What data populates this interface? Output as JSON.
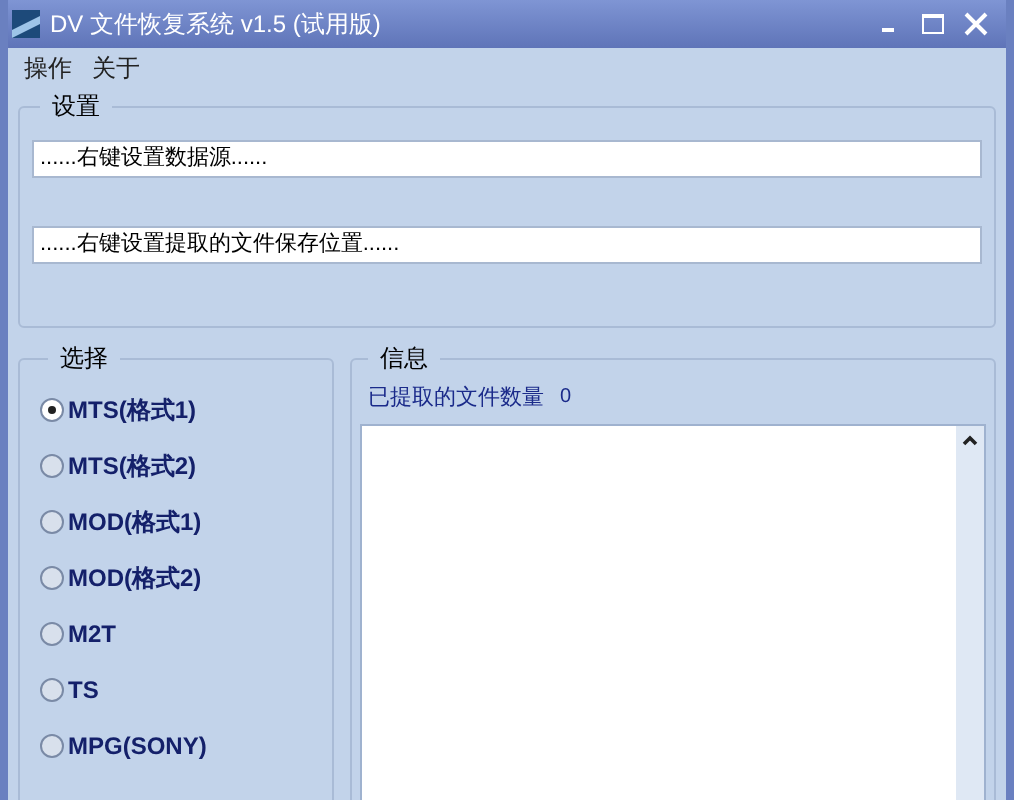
{
  "window": {
    "title": "DV 文件恢复系统 v1.5 (试用版)"
  },
  "menu": [
    "操作",
    "关于"
  ],
  "settings": {
    "title": "设置",
    "fields": [
      {
        "value": "......右键设置数据源......"
      },
      {
        "value": "......右键设置提取的文件保存位置......"
      }
    ]
  },
  "selection": {
    "title": "选择",
    "options": [
      {
        "label": "MTS(格式1)",
        "selected": true
      },
      {
        "label": "MTS(格式2)",
        "selected": false
      },
      {
        "label": "MOD(格式1)",
        "selected": false
      },
      {
        "label": "MOD(格式2)",
        "selected": false
      },
      {
        "label": "M2T",
        "selected": false
      },
      {
        "label": "TS",
        "selected": false
      },
      {
        "label": "MPG(SONY)",
        "selected": false
      }
    ]
  },
  "info": {
    "title": "信息",
    "count_label": "已提取的文件数量",
    "count": "0"
  }
}
